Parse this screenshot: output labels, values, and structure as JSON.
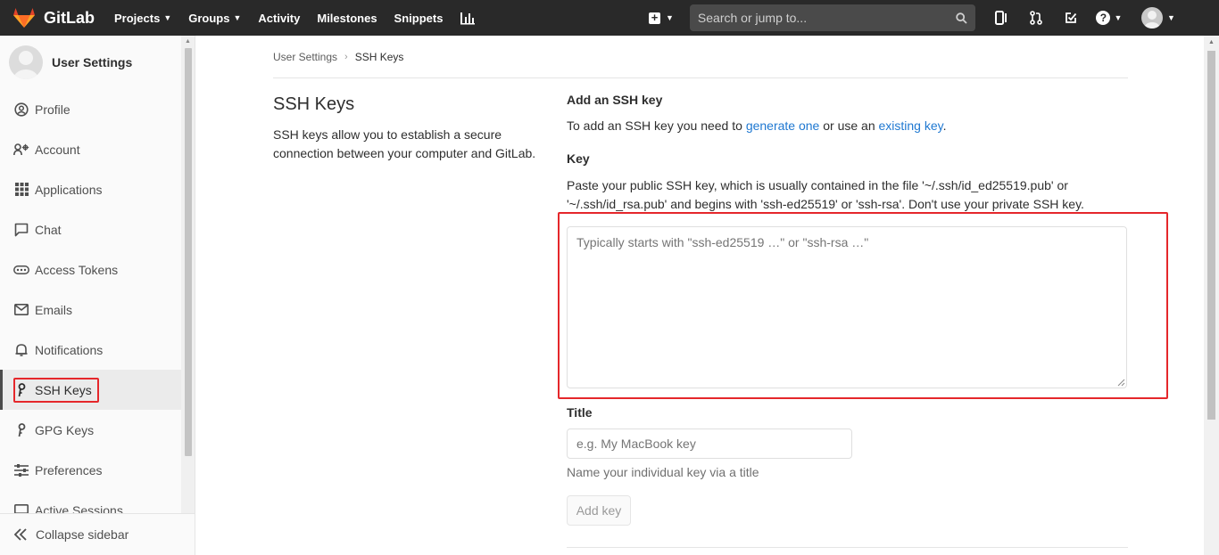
{
  "app": {
    "name": "GitLab"
  },
  "nav": {
    "links": [
      {
        "label": "Projects",
        "dropdown": true
      },
      {
        "label": "Groups",
        "dropdown": true
      },
      {
        "label": "Activity",
        "dropdown": false
      },
      {
        "label": "Milestones",
        "dropdown": false
      },
      {
        "label": "Snippets",
        "dropdown": false
      }
    ],
    "search_placeholder": "Search or jump to...",
    "icons": [
      "plus-icon",
      "search-icon",
      "issues-icon",
      "merge-request-icon",
      "todo-icon",
      "help-icon",
      "avatar"
    ]
  },
  "sidebar": {
    "title": "User Settings",
    "items": [
      {
        "label": "Profile",
        "icon": "profile-icon"
      },
      {
        "label": "Account",
        "icon": "account-icon"
      },
      {
        "label": "Applications",
        "icon": "applications-icon"
      },
      {
        "label": "Chat",
        "icon": "chat-icon"
      },
      {
        "label": "Access Tokens",
        "icon": "access-tokens-icon"
      },
      {
        "label": "Emails",
        "icon": "emails-icon"
      },
      {
        "label": "Notifications",
        "icon": "notifications-icon"
      },
      {
        "label": "SSH Keys",
        "icon": "key-icon",
        "active": true
      },
      {
        "label": "GPG Keys",
        "icon": "key-icon"
      },
      {
        "label": "Preferences",
        "icon": "preferences-icon"
      },
      {
        "label": "Active Sessions",
        "icon": "sessions-icon"
      }
    ],
    "collapse_label": "Collapse sidebar"
  },
  "breadcrumb": {
    "parent": "User Settings",
    "current": "SSH Keys"
  },
  "left": {
    "title": "SSH Keys",
    "description": "SSH keys allow you to establish a secure connection between your computer and GitLab."
  },
  "form": {
    "section_title": "Add an SSH key",
    "intro_prefix": "To add an SSH key you need to ",
    "intro_link1": "generate one",
    "intro_middle": " or use an ",
    "intro_link2": "existing key",
    "intro_suffix": ".",
    "key_label": "Key",
    "key_help": "Paste your public SSH key, which is usually contained in the file '~/.ssh/id_ed25519.pub' or '~/.ssh/id_rsa.pub' and begins with 'ssh-ed25519' or 'ssh-rsa'. Don't use your private SSH key.",
    "key_placeholder": "Typically starts with \"ssh-ed25519 …\" or \"ssh-rsa …\"",
    "key_value": "",
    "title_label": "Title",
    "title_placeholder": "e.g. My MacBook key",
    "title_value": "",
    "title_hint": "Name your individual key via a title",
    "add_button": "Add key"
  },
  "colors": {
    "navbar": "#292929",
    "link": "#1f78d1",
    "highlight": "#e5272b"
  }
}
